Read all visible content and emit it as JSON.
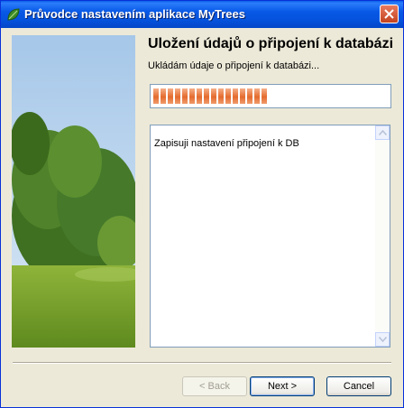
{
  "window": {
    "title": "Průvodce nastavením aplikace MyTrees"
  },
  "header": {
    "title": "Uložení údajů o připojení k databázi",
    "subtitle": "Ukládám údaje o připojení k databázi..."
  },
  "progress": {
    "value_percent": 50
  },
  "log": {
    "text": "Zapisuji nastavení připojení k DB"
  },
  "buttons": {
    "back": "< Back",
    "next": "Next >",
    "cancel": "Cancel"
  },
  "colors": {
    "titlebar": "#0553dd",
    "progress_fill": "#e46b2e",
    "dialog_bg": "#ece9d8"
  },
  "icons": {
    "app": "leaf-icon",
    "close": "close-icon"
  }
}
